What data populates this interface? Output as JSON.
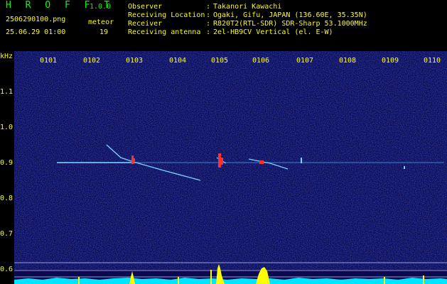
{
  "header": {
    "app_title": "H R O F F T",
    "app_version": "1.0.0",
    "file_name": "2506290100.png",
    "date_time": "25.06.29 01:00",
    "meteor_label": "meteor",
    "meteor_count": "19",
    "info": [
      {
        "label": "Observer",
        "value": "Takanori Kawachi"
      },
      {
        "label": "Receiving Location",
        "value": "Ogaki, Gifu, JAPAN (136.60E, 35.35N)"
      },
      {
        "label": "Receiver",
        "value": "R820T2(RTL-SDR) SDR-Sharp 53.1000MHz"
      },
      {
        "label": "Receiving antenna",
        "value": "2el-HB9CV Vertical (el. E-W)"
      }
    ],
    "separator": ":"
  },
  "axis": {
    "y_unit": "kHz",
    "y_ticks": [
      "1.1",
      "1.0",
      "0.9",
      "0.8",
      "0.7",
      "0.6"
    ],
    "x_ticks": [
      "0101",
      "0102",
      "0103",
      "0104",
      "0105",
      "0106",
      "0107",
      "0108",
      "0109",
      "0110"
    ]
  },
  "colors": {
    "background": "#0a0a50",
    "text_yellow": "#ffff00",
    "text_green": "#00ff00",
    "signal_band": "#5ab4ff",
    "meteor_red": "#ff3030",
    "baseline_cyan": "#00e5ff",
    "peak_yellow": "#ffff00"
  }
}
